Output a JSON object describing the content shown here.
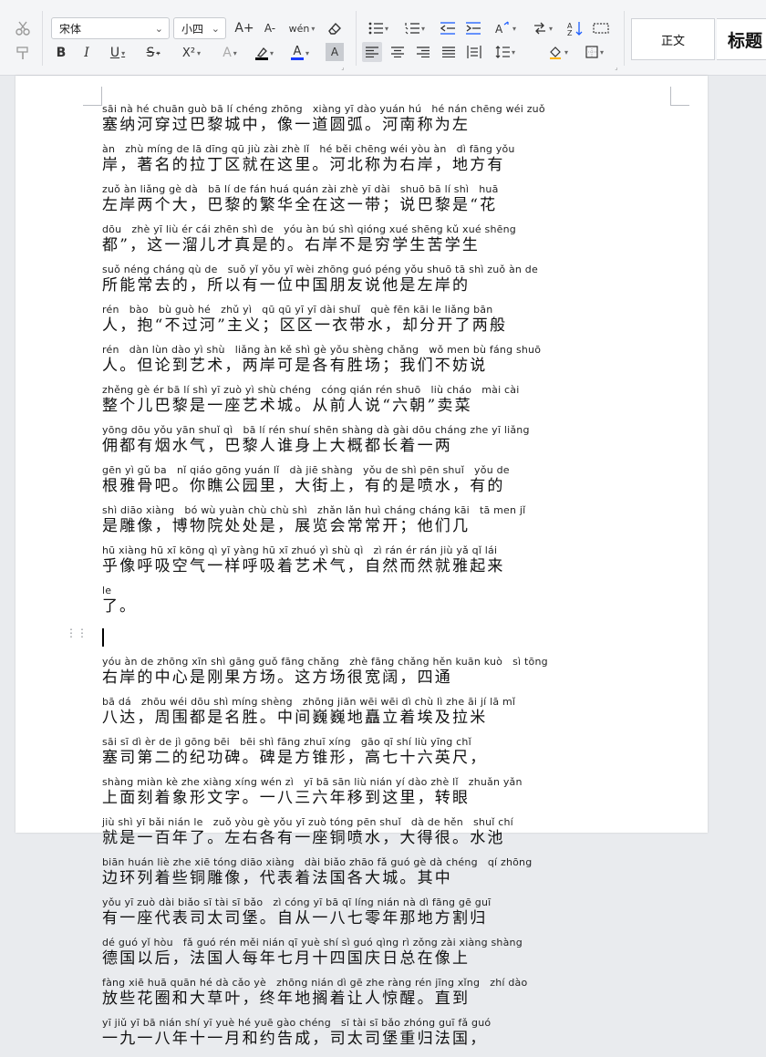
{
  "toolbar": {
    "font_name": "宋体",
    "font_size": "小四",
    "styles": [
      {
        "label": "正文"
      },
      {
        "label": "标题"
      }
    ],
    "icons": {
      "cut": "scissors-icon",
      "format_painter": "format-painter-icon",
      "bold": "B",
      "italic": "I",
      "underline": "U",
      "strikethrough": "S",
      "superscript": "X²",
      "grow_font": "A+",
      "shrink_font": "A-",
      "phonetic": "wén",
      "font_color": "A",
      "highlight": "A",
      "char_shading": "A",
      "clear_format": "eraser-icon"
    },
    "colors": {
      "font_color_bar": "#1a3cff",
      "highlight_bar": "#000000",
      "active_button_bg": "#d9dbe0"
    }
  },
  "document": {
    "paragraphs": [
      {
        "lines": [
          {
            "py": "sāi nà hé chuān guò bā lí chéng zhōng   xiàng yī dào yuán hú   hé nán chēng wéi zuǒ",
            "hz": "塞纳河穿过巴黎城中，像一道圆弧。河南称为左"
          },
          {
            "py": "àn   zhù míng de lā dīng qū jiù zài zhè lǐ   hé běi chēng wéi yòu àn   dì fāng yǒu",
            "hz": "岸，著名的拉丁区就在这里。河北称为右岸，地方有"
          },
          {
            "py": "zuǒ àn liǎng gè dà   bā lí de fán huá quán zài zhè yī dài   shuō bā lí shì   huā",
            "hz": "左岸两个大，巴黎的繁华全在这一带；说巴黎是“花"
          },
          {
            "py": "dōu   zhè yī liù ér cái zhēn shì de   yóu àn bú shì qióng xué shēng kǔ xué shēng",
            "hz": "都”，这一溜儿才真是的。右岸不是穷学生苦学生"
          },
          {
            "py": "suǒ néng cháng qù de   suǒ yǐ yǒu yī wèi zhōng guó péng yǒu shuō tā shì zuǒ àn de",
            "hz": "所能常去的，所以有一位中国朋友说他是左岸的"
          },
          {
            "py": "rén   bào   bù guò hé   zhǔ yì   qū qū yī yī dài shuǐ   què fēn kāi le liǎng bān",
            "hz": "人，抱“不过河”主义；区区一衣带水，却分开了两般"
          },
          {
            "py": "rén   dàn lùn dào yì shù   liǎng àn kě shì gè yǒu shèng chǎng   wǒ men bù fáng shuō",
            "hz": "人。但论到艺术，两岸可是各有胜场；我们不妨说"
          },
          {
            "py": "zhěng gè ér bā lí shì yī zuò yì shù chéng   cóng qián rén shuō   liù cháo   mài cài",
            "hz": "整个儿巴黎是一座艺术城。从前人说“六朝”卖菜"
          },
          {
            "py": "yōng dōu yǒu yān shuǐ qì   bā lí rén shuí shēn shàng dà gài dōu cháng zhe yī liǎng",
            "hz": "佣都有烟水气，巴黎人谁身上大概都长着一两"
          },
          {
            "py": "gēn yì gǔ ba   nǐ qiáo gōng yuán lǐ   dà jiē shàng   yǒu de shì pēn shuǐ   yǒu de",
            "hz": "根雅骨吧。你瞧公园里，大街上，有的是喷水，有的"
          },
          {
            "py": "shì diāo xiàng   bó wù yuàn chù chù shì   zhǎn lǎn huì cháng cháng kāi   tā men jǐ",
            "hz": "是雕像，博物院处处是，展览会常常开；他们几"
          },
          {
            "py": "hū xiàng hū xī kōng qì yī yàng hū xī zhuó yì shù qì   zì rán ér rán jiù yǎ qǐ lái",
            "hz": "乎像呼吸空气一样呼吸着艺术气，自然而然就雅起来"
          },
          {
            "py": "le",
            "hz": "了。"
          }
        ]
      },
      {
        "lines": [
          {
            "py": "yóu àn de zhōng xīn shì gāng guǒ fāng chǎng   zhè fāng chǎng hěn kuān kuò   sì tōng",
            "hz": "右岸的中心是刚果方场。这方场很宽阔，四通"
          },
          {
            "py": "bā dá   zhōu wéi dōu shì míng shèng   zhōng jiān wēi wēi dì chù lì zhe āi jí lā mǐ",
            "hz": "八达，周围都是名胜。中间巍巍地矗立着埃及拉米"
          },
          {
            "py": "sāi sī dì èr de jì gōng bēi   bēi shì fāng zhuī xíng   gāo qī shí liù yīng chǐ",
            "hz": "塞司第二的纪功碑。碑是方锥形，高七十六英尺，"
          },
          {
            "py": "shàng miàn kè zhe xiàng xíng wén zì   yī bā sān liù nián yí dào zhè lǐ   zhuǎn yǎn",
            "hz": "上面刻着象形文字。一八三六年移到这里，转眼"
          },
          {
            "py": "jiù shì yī bǎi nián le   zuǒ yòu gè yǒu yī zuò tóng pēn shuǐ   dà de hěn   shuǐ chí",
            "hz": "就是一百年了。左右各有一座铜喷水，大得很。水池"
          },
          {
            "py": "biān huán liè zhe xiē tóng diāo xiàng   dài biǎo zhāo fǎ guó gè dà chéng   qí zhōng",
            "hz": "边环列着些铜雕像，代表着法国各大城。其中"
          },
          {
            "py": "yǒu yī zuò dài biǎo sī tài sī bǎo   zì cóng yī bā qī líng nián nà dì fāng gē guī",
            "hz": "有一座代表司太司堡。自从一八七零年那地方割归"
          },
          {
            "py": "dé guó yǐ hòu   fǎ guó rén měi nián qī yuè shí sì guó qìng rì zǒng zài xiàng shàng",
            "hz": "德国以后，法国人每年七月十四国庆日总在像上"
          },
          {
            "py": "fàng xiē huā quān hé dà cǎo yè   zhōng nián dì gē zhe ràng rén jīng xǐng   zhí dào",
            "hz": "放些花圈和大草叶，终年地搁着让人惊醒。直到"
          },
          {
            "py": "yī jiǔ yī bā nián shí yī yuè hé yuē gào chéng   sī tài sī bǎo zhóng guī fǎ guó",
            "hz": "一九一八年十一月和约告成，司太司堡重归法国，"
          }
        ]
      }
    ]
  }
}
